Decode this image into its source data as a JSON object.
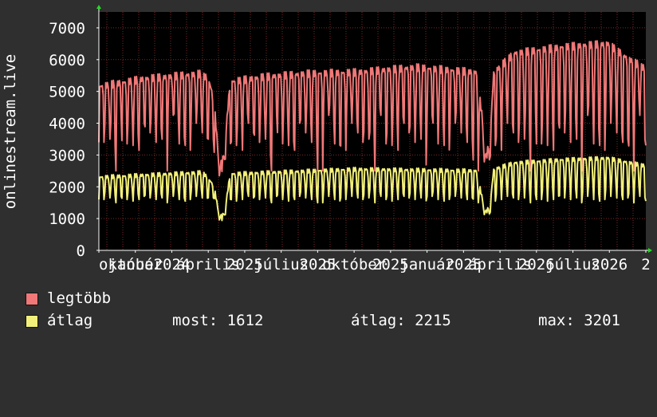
{
  "chart_data": {
    "type": "line",
    "ylabel": "onlinestream.live",
    "ylim": [
      0,
      7500
    ],
    "yticks": [
      0,
      1000,
      2000,
      3000,
      4000,
      5000,
      6000,
      7000
    ],
    "xticks": [
      "október",
      "január",
      "2024",
      "április",
      "2025",
      "július",
      "2025",
      "október",
      "2025",
      "január",
      "2025",
      "április",
      "2026",
      "július",
      "2026",
      "2"
    ],
    "grid": true,
    "colors": {
      "background": "#000000",
      "grid": "#7a2a2a",
      "axis": "#ffffff"
    },
    "series": [
      {
        "name": "legtöbb",
        "color": "#f07878",
        "x_range": [
          0,
          1
        ],
        "segments": [
          [
            0.0,
            5150
          ],
          [
            0.085,
            5400
          ],
          [
            0.185,
            5550
          ],
          [
            0.2,
            5400
          ],
          [
            0.21,
            4800
          ],
          [
            0.218,
            3100
          ],
          [
            0.225,
            2600
          ],
          [
            0.232,
            3700
          ],
          [
            0.24,
            5300
          ],
          [
            0.3,
            5450
          ],
          [
            0.375,
            5550
          ],
          [
            0.475,
            5600
          ],
          [
            0.54,
            5700
          ],
          [
            0.58,
            5750
          ],
          [
            0.69,
            5600
          ],
          [
            0.7,
            4300
          ],
          [
            0.708,
            2900
          ],
          [
            0.715,
            3500
          ],
          [
            0.722,
            5600
          ],
          [
            0.76,
            6200
          ],
          [
            0.85,
            6400
          ],
          [
            0.93,
            6500
          ],
          [
            0.97,
            6000
          ],
          [
            1.0,
            5700
          ]
        ],
        "troughs": [
          3400,
          3500,
          2500,
          4250,
          3350,
          3300,
          3150,
          4000,
          3700
        ]
      },
      {
        "name": "átlag",
        "color": "#f2f07a",
        "x_range": [
          0,
          1
        ],
        "segments": [
          [
            0.0,
            2300
          ],
          [
            0.19,
            2450
          ],
          [
            0.21,
            2050
          ],
          [
            0.218,
            1300
          ],
          [
            0.225,
            1000
          ],
          [
            0.232,
            1450
          ],
          [
            0.24,
            2400
          ],
          [
            0.47,
            2550
          ],
          [
            0.69,
            2500
          ],
          [
            0.7,
            1700
          ],
          [
            0.708,
            1200
          ],
          [
            0.715,
            1400
          ],
          [
            0.722,
            2550
          ],
          [
            0.76,
            2750
          ],
          [
            0.85,
            2850
          ],
          [
            0.93,
            2900
          ],
          [
            1.0,
            2650
          ]
        ],
        "troughs": [
          1600,
          1650,
          1500,
          1700,
          1600,
          1550,
          1600,
          1700,
          1650
        ]
      }
    ]
  },
  "legend": [
    {
      "label": "legtöbb",
      "color": "#f07878"
    },
    {
      "label": "átlag",
      "color": "#f2f07a"
    }
  ],
  "stats": {
    "most": "most: 1612",
    "atlag": "átlag: 2215",
    "max": "max: 3201"
  }
}
